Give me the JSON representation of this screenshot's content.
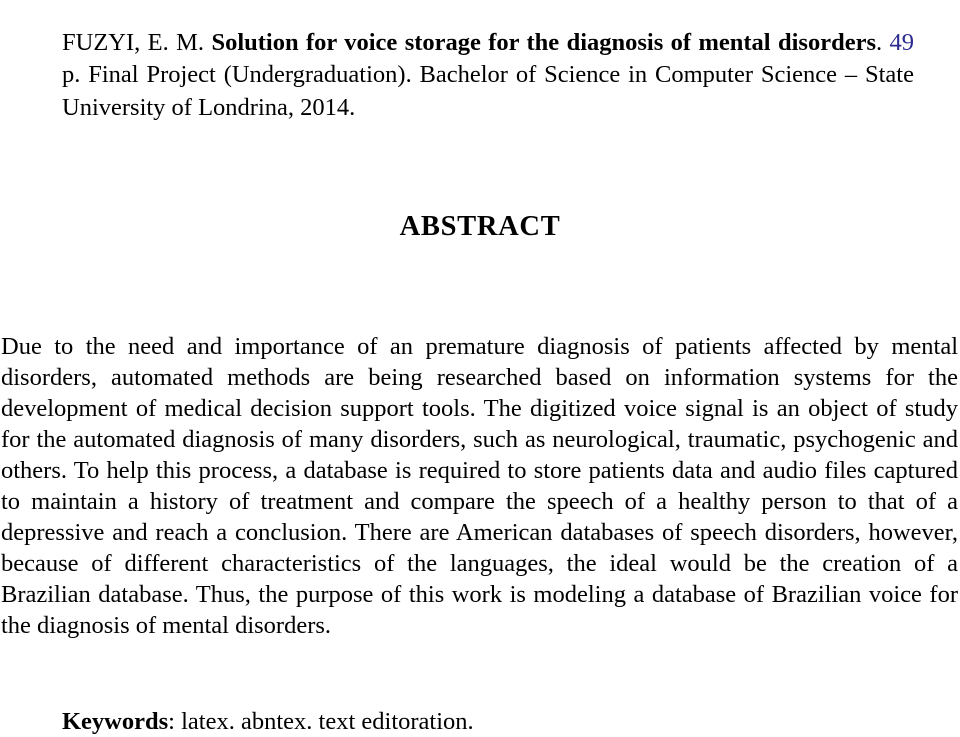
{
  "document": {
    "reference": {
      "author": "FUZYI, E. M. ",
      "title_bold": "Solution for voice storage for the diagnosis of mental disorders",
      "after_title": ". ",
      "pages_link": "49",
      "tail": " p. Final Project (Undergraduation). Bachelor of Science in Computer Science – State University of Londrina, 2014.",
      "link_color": "#2b2b8f"
    },
    "section": {
      "heading": "ABSTRACT"
    },
    "abstract": {
      "paragraph": "Due to the need and importance of an premature diagnosis of patients affected by mental disorders, automated methods are being researched based on information systems for the development of medical decision support tools. The digitized voice signal is an object of study for the automated diagnosis of many disorders, such as neurological, traumatic, psychogenic and others. To help this process, a database is required to store patients data and audio files captured to maintain a history of treatment and compare the speech of a healthy person to that of a depressive and reach a conclusion. There are American databases of speech disorders, however, because of different characteristics of the languages, the ideal would be the creation of a Brazilian database. Thus, the purpose of this work is modeling a database of Brazilian voice for the diagnosis of mental disorders."
    },
    "keywords": {
      "label": "Keywords",
      "values": ": latex. abntex. text editoration."
    }
  }
}
